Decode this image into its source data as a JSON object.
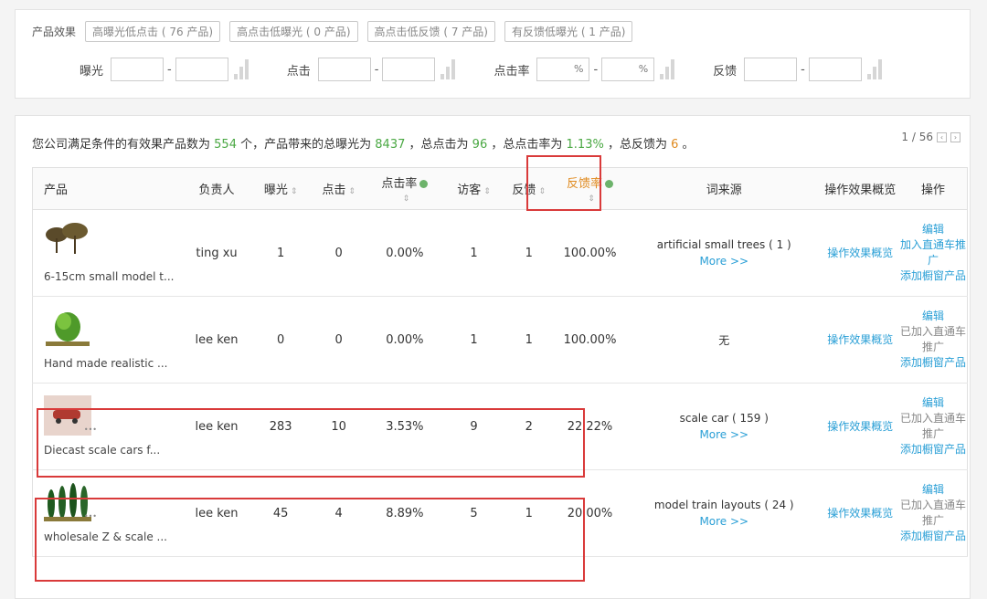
{
  "filter": {
    "label": "产品效果",
    "buttons": [
      "高曝光低点击 ( 76 产品)",
      "高点击低曝光 ( 0 产品)",
      "高点击低反馈 ( 7 产品)",
      "有反馈低曝光 ( 1 产品)"
    ],
    "ranges": [
      {
        "label": "曝光",
        "percent": false
      },
      {
        "label": "点击",
        "percent": false
      },
      {
        "label": "点击率",
        "percent": true
      },
      {
        "label": "反馈",
        "percent": false
      }
    ],
    "separator": "-",
    "percent_sign": "%"
  },
  "summary": {
    "prefix": "您公司满足条件的有效果产品数为",
    "products": "554",
    "part2": "个，产品带来的总曝光为",
    "exposure": "8437",
    "part3": "，总点击为",
    "clicks": "96",
    "part4": "，总点击率为",
    "ctr": "1.13%",
    "part5": "，总反馈为",
    "feedback": "6",
    "suffix": "。"
  },
  "pager": {
    "text": "1 / 56",
    "prev": "‹",
    "next": "›"
  },
  "table": {
    "headers": {
      "product": "产品",
      "owner": "负责人",
      "exposure": "曝光",
      "clicks": "点击",
      "ctr": "点击率",
      "visitors": "访客",
      "feedback": "反馈",
      "feedback_rate": "反馈率",
      "keyword_source": "词来源",
      "overview": "操作效果概览",
      "action": "操作"
    },
    "sort_glyph": "⇕",
    "rows": [
      {
        "name": "6-15cm small model t...",
        "owner": "ting xu",
        "exposure": "1",
        "clicks": "0",
        "ctr": "0.00%",
        "visitors": "1",
        "feedback": "1",
        "feedback_rate": "100.00%",
        "keyword": "artificial small trees ( 1 )",
        "more": "More >>",
        "overview": "操作效果概览",
        "edit": "编辑",
        "status": "加入直通车推广",
        "status_active": true,
        "add_window": "添加橱窗产品",
        "thumb": "tree"
      },
      {
        "name": "Hand made realistic ...",
        "owner": "lee ken",
        "exposure": "0",
        "clicks": "0",
        "ctr": "0.00%",
        "visitors": "1",
        "feedback": "1",
        "feedback_rate": "100.00%",
        "keyword": "无",
        "more": "",
        "overview": "操作效果概览",
        "edit": "编辑",
        "status": "已加入直通车推广",
        "status_active": false,
        "add_window": "添加橱窗产品",
        "thumb": "bush"
      },
      {
        "name": "Diecast scale cars f...",
        "owner": "lee ken",
        "exposure": "283",
        "clicks": "10",
        "ctr": "3.53%",
        "visitors": "9",
        "feedback": "2",
        "feedback_rate": "22.22%",
        "keyword": "scale car ( 159 )",
        "more": "More >>",
        "overview": "操作效果概览",
        "edit": "编辑",
        "status": "已加入直通车推广",
        "status_active": false,
        "add_window": "添加橱窗产品",
        "thumb": "car"
      },
      {
        "name": "wholesale Z & scale ...",
        "owner": "lee ken",
        "exposure": "45",
        "clicks": "4",
        "ctr": "8.89%",
        "visitors": "5",
        "feedback": "1",
        "feedback_rate": "20.00%",
        "keyword": "model train layouts ( 24 )",
        "more": "More >>",
        "overview": "操作效果概览",
        "edit": "编辑",
        "status": "已加入直通车推广",
        "status_active": false,
        "add_window": "添加橱窗产品",
        "thumb": "cypress"
      }
    ]
  },
  "colors": {
    "link": "#2a9fd6",
    "highlight": "#d93a3a",
    "green": "#4aa843",
    "orange": "#e08a1e"
  }
}
